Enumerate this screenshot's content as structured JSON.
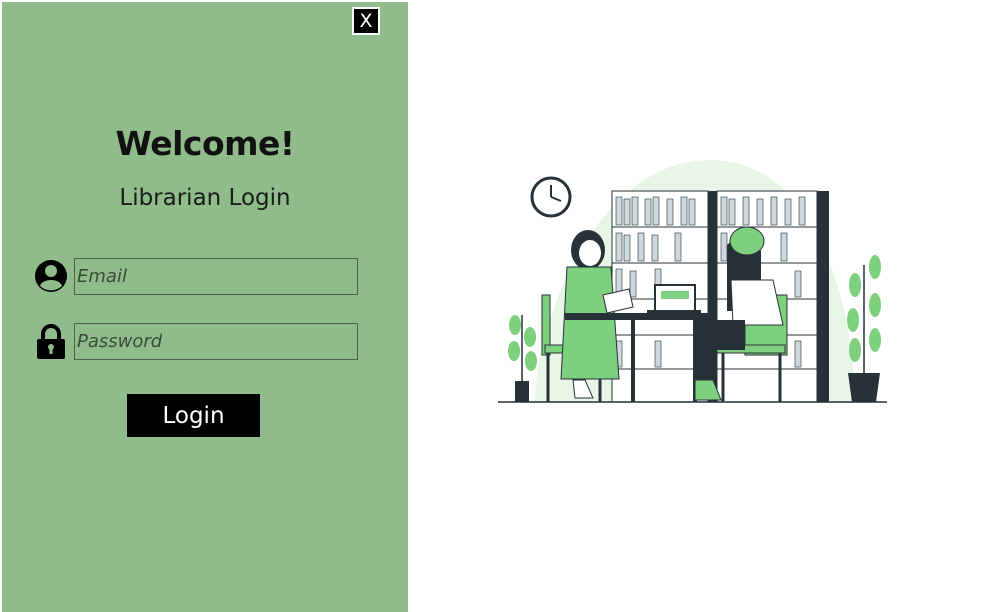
{
  "close_button": {
    "label": "X"
  },
  "login_panel": {
    "heading": "Welcome!",
    "subheading": "Librarian Login",
    "email": {
      "placeholder": "Email",
      "value": ""
    },
    "password": {
      "placeholder": "Password",
      "value": ""
    },
    "login_label": "Login"
  },
  "icons": {
    "email_icon": "user-avatar-icon",
    "password_icon": "padlock-icon"
  },
  "colors": {
    "panel_background": "#8fbc8a",
    "button_background": "#000000",
    "illustration_accent": "#7ed07e"
  }
}
